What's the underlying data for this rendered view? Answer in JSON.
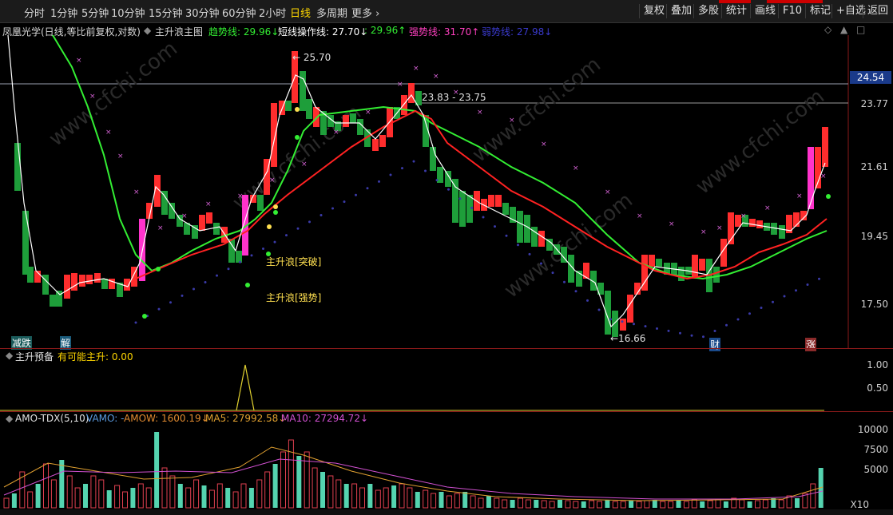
{
  "toolbar": {
    "periods": [
      "分时",
      "1分钟",
      "5分钟",
      "10分钟",
      "15分钟",
      "30分钟",
      "60分钟",
      "2小时",
      "日线",
      "多周期",
      "更多 ›"
    ],
    "active_period": "日线",
    "buttons": [
      "复权",
      "叠加",
      "多股",
      "统计",
      "画线",
      "F10",
      "标记",
      "+自选",
      "返回"
    ]
  },
  "main_panel": {
    "stock_title": "凤凰光学(日线,等比前复权,对数)",
    "indicator_name": "主升浪主图",
    "trend_label": "趋势线: 29.96↓",
    "short_label": "短线操作线: 27.70↓",
    "short_value": ": 29.96↑",
    "strong_label": "强势线: 31.70↑",
    "weak_label": "弱势线: 27.98↓",
    "current_price": "24.54",
    "y_ticks": [
      "23.77",
      "21.61",
      "19.45",
      "17.50"
    ],
    "annotations": {
      "high": "← 25.70",
      "range": "23.83 - 23.75",
      "low": "←16.66",
      "breakout": "主升浪[突破]",
      "strength": "主升浪[强势]"
    },
    "events": {
      "e1": "减跌",
      "e2": "解",
      "e3": "财",
      "e4": "涨"
    },
    "watermark": "www.cfchi.com"
  },
  "mid_panel": {
    "title": "主升预备",
    "value_label": "有可能主升: 0.00",
    "y_ticks": [
      "1.00",
      "0.50"
    ]
  },
  "vol_panel": {
    "title": "AMO-TDX(5,10)",
    "vamo": "VAMO: -",
    "amow": "AMOW: 1600.19↓",
    "ma5": "MA5: 27992.58↓",
    "ma10": "MA10: 27294.72↓",
    "y_ticks": [
      "10000",
      "7500",
      "5000"
    ],
    "unit": "X10"
  },
  "colors": {
    "up": "#ff2d2d",
    "down": "#1e9e3a",
    "trend": "#33ee33",
    "short": "#ffffff",
    "red_line": "#ff2222",
    "strong": "#d060d0",
    "weak": "#3a3aa8",
    "vol": "#55d4b0"
  }
}
